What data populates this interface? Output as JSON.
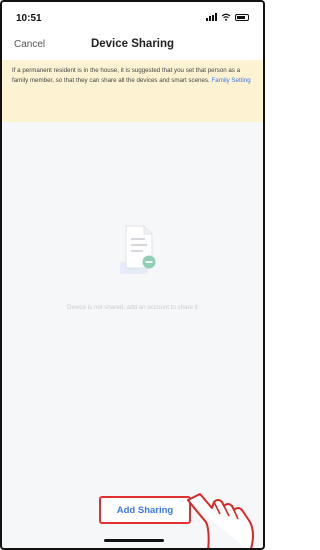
{
  "status_bar": {
    "time": "10:51"
  },
  "nav": {
    "cancel_label": "Cancel",
    "title": "Device Sharing"
  },
  "notice": {
    "text": "If a permanent resident is in the house, it is suggested that you set that person as a family member, so that they can share all the devices and smart scenes.",
    "link": "Family Setting"
  },
  "empty_state": {
    "message": "Device is not shared, add an account to share it"
  },
  "footer": {
    "add_sharing_label": "Add Sharing"
  },
  "colors": {
    "accent": "#3b78e7",
    "highlight_border": "#e03030",
    "notice_bg": "#fdf3d3"
  },
  "icons": [
    "signal-icon",
    "wifi-icon",
    "battery-icon",
    "empty-document-icon",
    "pointing-hand-icon"
  ]
}
